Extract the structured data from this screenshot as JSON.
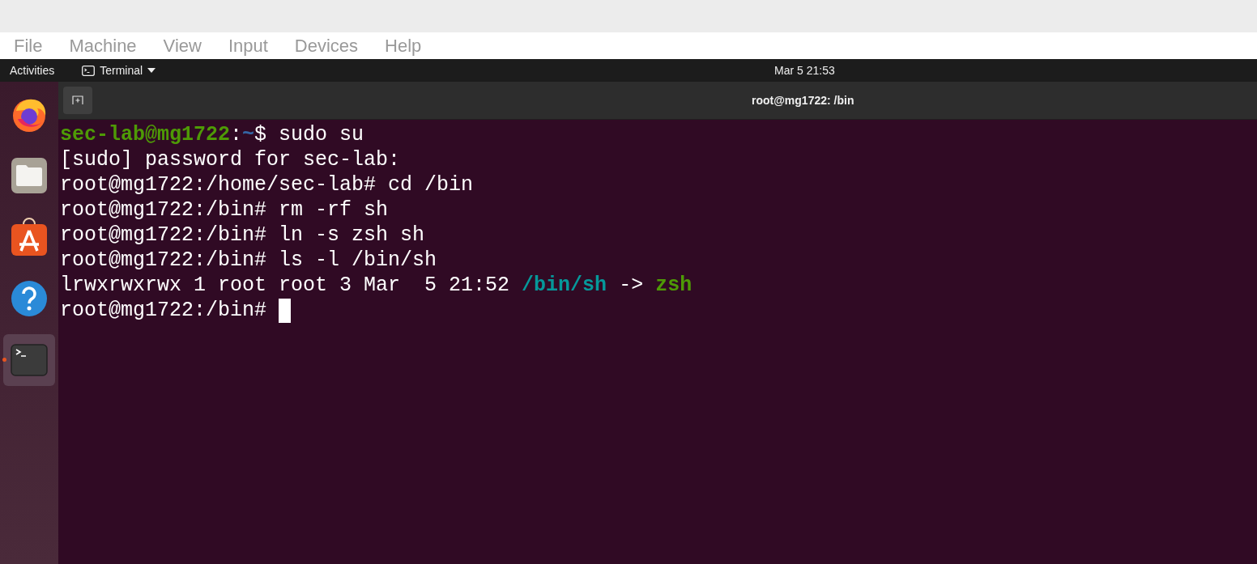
{
  "menu_bar": {
    "items": [
      "File",
      "Machine",
      "View",
      "Input",
      "Devices",
      "Help"
    ]
  },
  "top_bar": {
    "activities": "Activities",
    "app_menu": "Terminal",
    "clock": "Mar 5  21:53"
  },
  "dock": {
    "items": [
      {
        "kind": "firefox",
        "running": false,
        "selected": false
      },
      {
        "kind": "files",
        "running": false,
        "selected": false
      },
      {
        "kind": "software",
        "running": false,
        "selected": false
      },
      {
        "kind": "help",
        "running": false,
        "selected": false
      },
      {
        "kind": "terminal",
        "running": true,
        "selected": true
      }
    ]
  },
  "terminal": {
    "title": "root@mg1722: /bin",
    "lines": [
      {
        "segments": [
          {
            "kind": "user",
            "text": "sec-lab@mg1722"
          },
          {
            "kind": "plain",
            "text": ":"
          },
          {
            "kind": "path",
            "text": "~"
          },
          {
            "kind": "plain",
            "text": "$ sudo su"
          }
        ],
        "cursor": false
      },
      {
        "segments": [
          {
            "kind": "plain",
            "text": "[sudo] password for sec-lab:"
          }
        ],
        "cursor": false
      },
      {
        "segments": [
          {
            "kind": "plain",
            "text": "root@mg1722:/home/sec-lab# cd /bin"
          }
        ],
        "cursor": false
      },
      {
        "segments": [
          {
            "kind": "plain",
            "text": "root@mg1722:/bin# rm -rf sh"
          }
        ],
        "cursor": false
      },
      {
        "segments": [
          {
            "kind": "plain",
            "text": "root@mg1722:/bin# ln -s zsh sh"
          }
        ],
        "cursor": false
      },
      {
        "segments": [
          {
            "kind": "plain",
            "text": "root@mg1722:/bin# ls -l /bin/sh"
          }
        ],
        "cursor": false
      },
      {
        "segments": [
          {
            "kind": "plain",
            "text": "lrwxrwxrwx 1 root root 3 Mar  5 21:52 "
          },
          {
            "kind": "link",
            "text": "/bin/sh"
          },
          {
            "kind": "plain",
            "text": " -> "
          },
          {
            "kind": "target",
            "text": "zsh"
          }
        ],
        "cursor": false
      },
      {
        "segments": [
          {
            "kind": "plain",
            "text": "root@mg1722:/bin# "
          }
        ],
        "cursor": true
      }
    ]
  }
}
